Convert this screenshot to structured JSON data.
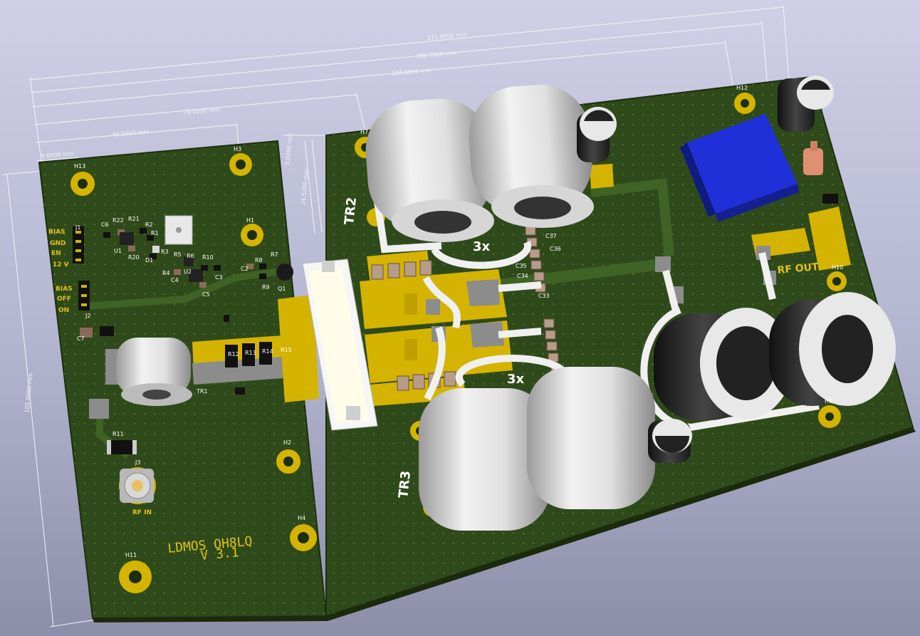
{
  "viewer": {
    "background_top": "#cfd0e6",
    "background_bottom": "#8d8ea8",
    "board_color": "#2f4a1a",
    "copper_color": "#d4b400",
    "silk_color": "#ffffff",
    "silk_yellow": "#e0c21a"
  },
  "dimensions": {
    "d211": "211.0000 mm",
    "d2027": "202.7000 mm",
    "d188": "188.0000 mm",
    "d78": "78.0000 mm",
    "d46": "46.0000 mm",
    "d9": "9.0000 mm",
    "d105": "105.0000 mm",
    "d245": "24.5200 mm",
    "d5": "5.0200 mm"
  },
  "board": {
    "title": "LDMOS OH8LQ",
    "version": "V 3.1",
    "rf_in": "RF IN",
    "rf_out": "RF OUT",
    "turns_top": "3x",
    "turns_bottom": "3x"
  },
  "connectors": {
    "j1_pins": [
      "BIAS",
      "GND",
      "EN",
      "12 V"
    ],
    "j2_pins": [
      "BIAS",
      "OFF",
      "ON"
    ]
  },
  "refs": {
    "holes": [
      "H13",
      "H3",
      "H1",
      "H2",
      "H4",
      "H11",
      "H7",
      "H12",
      "H10",
      "H8"
    ],
    "parts": [
      "J1",
      "J2",
      "J3",
      "C6",
      "R22",
      "R21",
      "R2",
      "U1",
      "R20",
      "R1",
      "R3",
      "R5",
      "R4",
      "D1",
      "R6",
      "U2",
      "R10",
      "C4",
      "C5",
      "C3",
      "C2",
      "R8",
      "R7",
      "R9",
      "Q1",
      "C7",
      "R11",
      "TR1",
      "R12",
      "R13",
      "R14",
      "R15",
      "C37",
      "C36",
      "C35",
      "C34",
      "C33",
      "TR2",
      "TR3"
    ]
  }
}
